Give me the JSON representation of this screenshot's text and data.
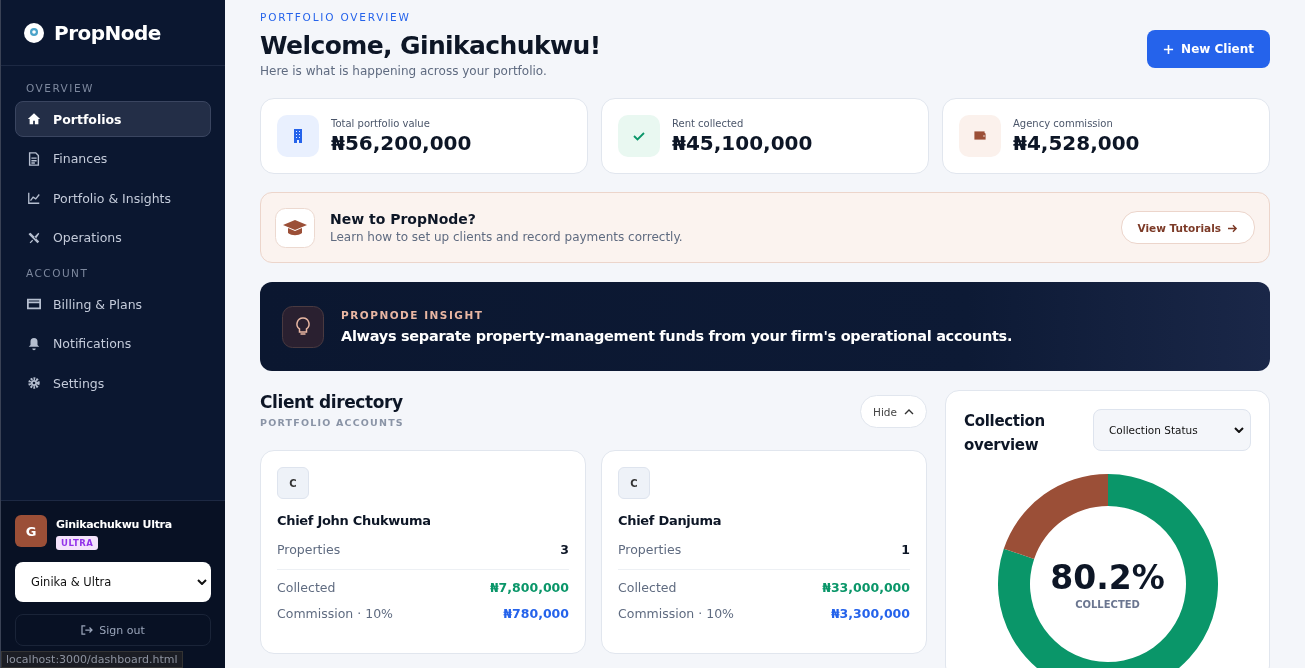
{
  "brand": {
    "name": "PropNode"
  },
  "sidebar": {
    "sections": [
      {
        "title": "OVERVIEW",
        "items": [
          {
            "label": "Portfolios",
            "selected": true
          },
          {
            "label": "Finances",
            "selected": false
          },
          {
            "label": "Portfolio & Insights",
            "selected": false
          },
          {
            "label": "Operations",
            "selected": false
          }
        ]
      },
      {
        "title": "ACCOUNT",
        "items": [
          {
            "label": "Billing & Plans",
            "selected": false
          },
          {
            "label": "Notifications",
            "selected": false
          },
          {
            "label": "Settings",
            "selected": false
          }
        ]
      }
    ],
    "user": {
      "initial": "G",
      "name": "Ginikachukwu Ultra",
      "badge": "ULTRA"
    },
    "workspace_select": {
      "value": "Ginika & Ultra"
    },
    "sign_out": "Sign out"
  },
  "status_url": "localhost:3000/dashboard.html",
  "header": {
    "eyebrow": "PORTFOLIO OVERVIEW",
    "title": "Welcome, Ginikachukwu!",
    "subtitle": "Here is what is happening across your portfolio.",
    "button": "New Client"
  },
  "stats": [
    {
      "label": "Total portfolio value",
      "value": "₦56,200,000"
    },
    {
      "label": "Rent collected",
      "value": "₦45,100,000"
    },
    {
      "label": "Agency commission",
      "value": "₦4,528,000"
    }
  ],
  "tutorial_banner": {
    "title": "New to PropNode?",
    "text": "Learn how to set up clients and record payments correctly.",
    "button": "View Tutorials"
  },
  "insight": {
    "eyebrow": "PROPNODE INSIGHT",
    "text": "Always separate property-management funds from your firm's operational accounts."
  },
  "directory": {
    "title": "Client directory",
    "subtitle": "PORTFOLIO ACCOUNTS",
    "toggle": "Hide",
    "clients": [
      {
        "initial": "C",
        "name": "Chief John Chukwuma",
        "properties_label": "Properties",
        "properties": "3",
        "collected_label": "Collected",
        "collected": "₦7,800,000",
        "commission_label": "Commission · 10%",
        "commission": "₦780,000"
      },
      {
        "initial": "C",
        "name": "Chief Danjuma",
        "properties_label": "Properties",
        "properties": "1",
        "collected_label": "Collected",
        "collected": "₦33,000,000",
        "commission_label": "Commission · 10%",
        "commission": "₦3,300,000"
      }
    ]
  },
  "collection": {
    "title": "Collection overview",
    "select": "Collection Status",
    "percent": "80.2%",
    "caption": "COLLECTED",
    "chart_data": {
      "type": "donut",
      "values": [
        80.2,
        19.8
      ]
    }
  }
}
